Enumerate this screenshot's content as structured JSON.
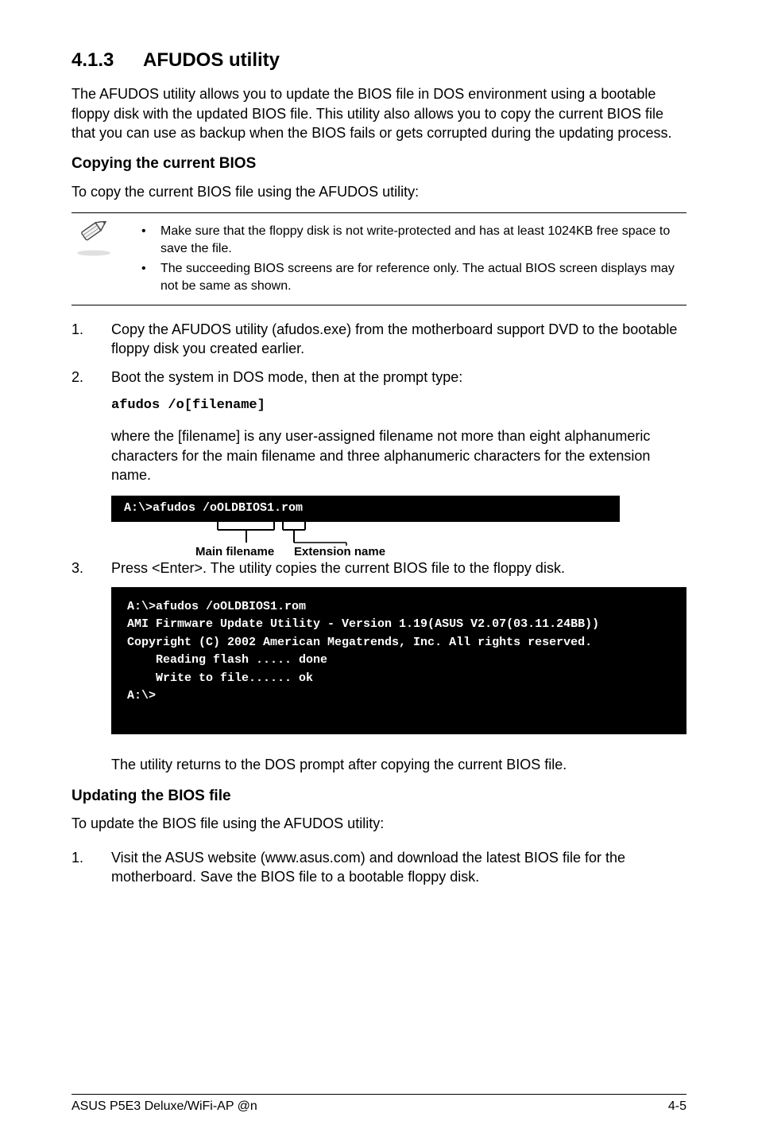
{
  "section": {
    "number": "4.1.3",
    "title": "AFUDOS utility",
    "intro": "The AFUDOS utility allows you to update the BIOS file in DOS environment using a bootable floppy disk with the updated BIOS file. This utility also allows you to copy the current BIOS file that you can use as backup when the BIOS fails or gets corrupted during the updating process."
  },
  "copying": {
    "heading": "Copying the current BIOS",
    "lead": "To copy the current BIOS file using the AFUDOS utility:",
    "notes": [
      "Make sure that the floppy disk is not write-protected and has at least 1024KB free space to save the file.",
      "The succeeding BIOS screens are for reference only. The actual BIOS screen displays may not be same as shown."
    ],
    "steps": {
      "1": "Copy the AFUDOS utility (afudos.exe) from the motherboard support DVD to the bootable floppy disk you created earlier.",
      "2": "Boot the system in DOS mode, then at the prompt type:",
      "cmd": "afudos /o[filename]",
      "explain": "where the [filename] is any user-assigned filename not more than eight alphanumeric characters  for the main filename and three alphanumeric characters for the extension name.",
      "term_small": "A:\\>afudos /oOLDBIOS1.rom",
      "caption_main": "Main filename",
      "caption_ext": "Extension name",
      "3": "Press <Enter>. The utility copies the current BIOS file to the floppy disk.",
      "term_large": "A:\\>afudos /oOLDBIOS1.rom\nAMI Firmware Update Utility - Version 1.19(ASUS V2.07(03.11.24BB))\nCopyright (C) 2002 American Megatrends, Inc. All rights reserved.\n    Reading flash ..... done\n    Write to file...... ok\nA:\\>\n ",
      "after_term": "The utility returns to the DOS prompt after copying the current BIOS file."
    }
  },
  "updating": {
    "heading": "Updating the BIOS file",
    "lead": "To update the BIOS file using the AFUDOS utility:",
    "steps": {
      "1": "Visit the ASUS website (www.asus.com) and download the latest BIOS file for the motherboard. Save the BIOS file to a bootable floppy disk."
    }
  },
  "footer": {
    "left": "ASUS P5E3 Deluxe/WiFi-AP @n",
    "right": "4-5"
  },
  "icons": {
    "note": "pencil-icon"
  }
}
